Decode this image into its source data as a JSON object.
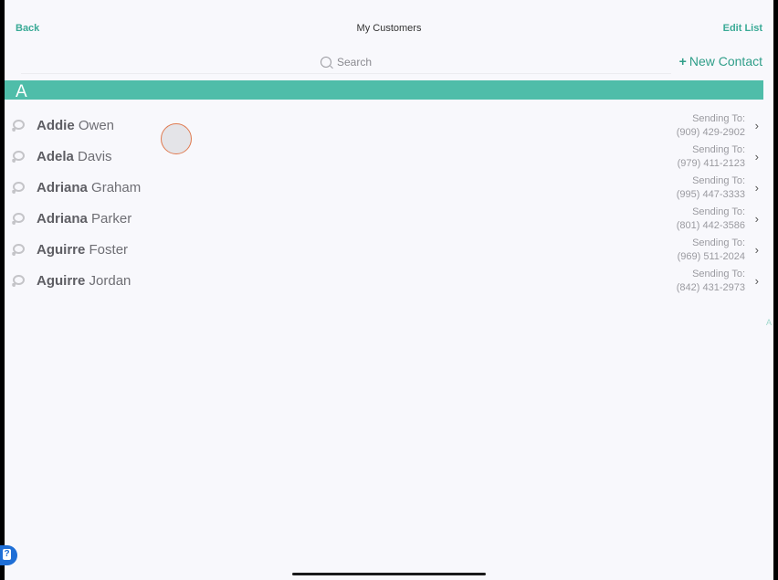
{
  "nav": {
    "back_label": "Back",
    "title": "My Customers",
    "edit_label": "Edit List"
  },
  "search": {
    "placeholder": "Search"
  },
  "new_contact": {
    "plus": "+",
    "label": "New Contact"
  },
  "section": {
    "letter": "A"
  },
  "contacts": [
    {
      "first": "Addie",
      "last": "Owen",
      "sending_label": "Sending To:",
      "phone": "(909) 429-2902"
    },
    {
      "first": "Adela",
      "last": "Davis",
      "sending_label": "Sending To:",
      "phone": "(979) 411-2123"
    },
    {
      "first": "Adriana",
      "last": "Graham",
      "sending_label": "Sending To:",
      "phone": "(995) 447-3333"
    },
    {
      "first": "Adriana",
      "last": "Parker",
      "sending_label": "Sending To:",
      "phone": "(801) 442-3586"
    },
    {
      "first": "Aguirre",
      "last": "Foster",
      "sending_label": "Sending To:",
      "phone": "(969) 511-2024"
    },
    {
      "first": "Aguirre",
      "last": "Jordan",
      "sending_label": "Sending To:",
      "phone": "(842) 431-2973"
    }
  ],
  "index": {
    "letters": [
      "A"
    ]
  },
  "chevron_glyph": "›",
  "help_glyph": "?",
  "colors": {
    "accent": "#4fbda9",
    "link": "#3aaa96",
    "help_badge": "#1f6fd6",
    "touch_ring": "#e07a50"
  }
}
